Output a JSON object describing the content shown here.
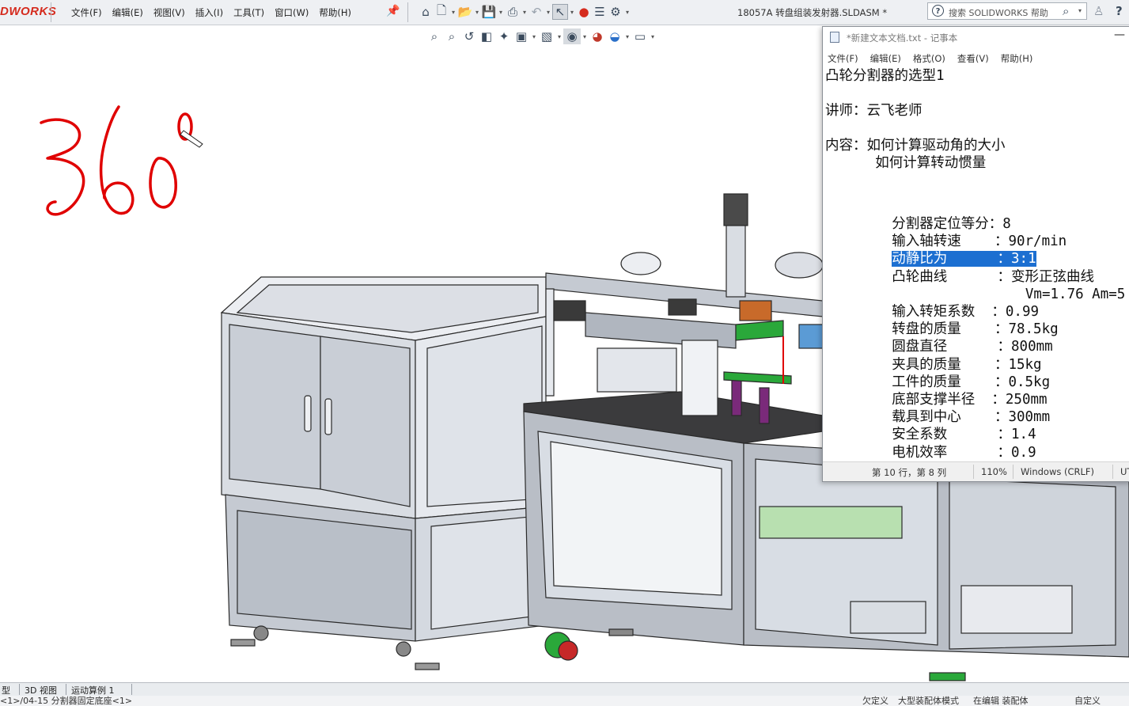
{
  "app": {
    "logo": "DWORKS",
    "menu": [
      "文件(F)",
      "编辑(E)",
      "视图(V)",
      "插入(I)",
      "工具(T)",
      "窗口(W)",
      "帮助(H)"
    ],
    "document_title": "18057A 转盘组装发射器.SLDASM *",
    "search_placeholder": "搜索 SOLIDWORKS 帮助",
    "toolbar_icons": [
      "home-icon",
      "new-file-icon",
      "open-icon",
      "save-icon",
      "print-icon",
      "undo-icon",
      "select-icon",
      "traffic-light-icon",
      "file-properties-icon",
      "options-icon"
    ],
    "headsup_icons": [
      "zoom-to-fit-icon",
      "zoom-area-icon",
      "previous-view-icon",
      "section-view-icon",
      "dynamic-annotation-icon",
      "view-orientation-icon",
      "display-style-icon",
      "hide-show-icon",
      "edit-appearance-icon",
      "scene-icon",
      "display-settings-icon"
    ]
  },
  "annotation": {
    "handwritten": "360°",
    "color": "#e00000"
  },
  "notepad": {
    "title": "*新建文本文档.txt - 记事本",
    "menu": [
      "文件(F)",
      "编辑(E)",
      "格式(O)",
      "查看(V)",
      "帮助(H)"
    ],
    "heading": "凸轮分割器的选型1",
    "lecturer": "讲师：云飞老师",
    "content_1": "内容：如何计算驱动角的大小",
    "content_2": "      如何计算转动惯量",
    "params": [
      {
        "label": "分割器定位等分",
        "sep": "：",
        "value": "8",
        "selected": false
      },
      {
        "label": "输入轴转速    ",
        "sep": "：",
        "value": "90r/min",
        "selected": false
      },
      {
        "label": "动静比为      ",
        "sep": "：",
        "value": "3:1",
        "selected": true
      },
      {
        "label": "凸轮曲线      ",
        "sep": "：",
        "value": "变形正弦曲线",
        "selected": false
      },
      {
        "label": "              ",
        "sep": "  ",
        "value": "Vm=1.76 Am=5",
        "selected": false
      },
      {
        "label": "输入转矩系数  ",
        "sep": "：",
        "value": "0.99",
        "selected": false
      },
      {
        "label": "转盘的质量    ",
        "sep": "：",
        "value": "78.5kg",
        "selected": false
      },
      {
        "label": "圆盘直径      ",
        "sep": "：",
        "value": "800mm",
        "selected": false
      },
      {
        "label": "夹具的质量    ",
        "sep": "：",
        "value": "15kg",
        "selected": false
      },
      {
        "label": "工件的质量    ",
        "sep": "：",
        "value": "0.5kg",
        "selected": false
      },
      {
        "label": "底部支撑半径  ",
        "sep": "：",
        "value": "250mm",
        "selected": false
      },
      {
        "label": "载具到中心    ",
        "sep": "：",
        "value": "300mm",
        "selected": false
      },
      {
        "label": "安全系数      ",
        "sep": "：",
        "value": "1.4",
        "selected": false
      },
      {
        "label": "电机效率      ",
        "sep": "：",
        "value": "0.9",
        "selected": false
      }
    ],
    "status": {
      "position": "第 10 行，第 8 列",
      "zoom": "110%",
      "line_ending": "Windows (CRLF)",
      "encoding": "UT"
    },
    "selection_color": "#1c6fd1"
  },
  "bottom_tabs": [
    "型",
    "3D 视图",
    "运动算例 1"
  ],
  "statusbar": {
    "left": "<1>/04-15 分割器固定底座<1>",
    "r1": "欠定义",
    "r2": "大型装配体模式",
    "r3": "在编辑 装配体",
    "r4": "自定义"
  }
}
